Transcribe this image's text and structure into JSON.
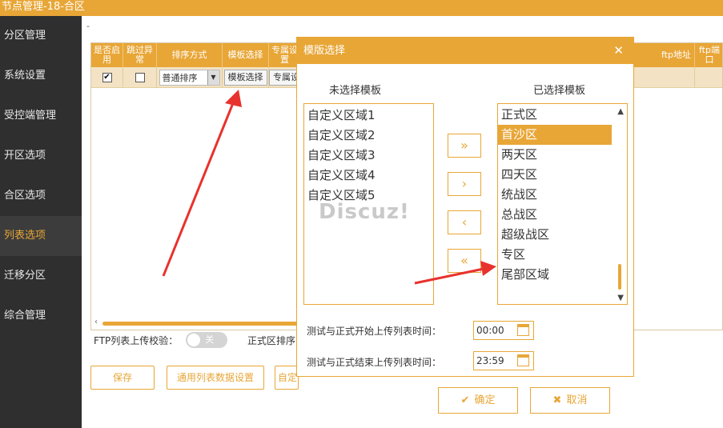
{
  "window": {
    "title": "节点管理-18-合区"
  },
  "sidebar": {
    "items": [
      {
        "label": "分区管理"
      },
      {
        "label": "系统设置"
      },
      {
        "label": "受控端管理"
      },
      {
        "label": "开区选项"
      },
      {
        "label": "合区选项"
      },
      {
        "label": "列表选项"
      },
      {
        "label": "迁移分区"
      },
      {
        "label": "综合管理"
      }
    ],
    "active_index": 5
  },
  "main": {
    "dash": "-",
    "table": {
      "headers": [
        "是否启用",
        "跳过异常",
        "排序方式",
        "模板选择",
        "专属设置",
        "ftp地址",
        "ftp端口"
      ],
      "row": {
        "enabled": true,
        "skip_error": false,
        "sort_value": "普通排序",
        "template_button": "模板选择",
        "exclusive_button": "专属设置"
      }
    },
    "ftp_check_label": "FTP列表上传校验：",
    "ftp_toggle_label": "关",
    "formal_sort_label": "正式区排序",
    "buttons": {
      "save": "保存",
      "common_list": "通用列表数据设置",
      "custom": "自定"
    }
  },
  "modal": {
    "title": "模版选择",
    "unselected_title": "未选择模板",
    "selected_title": "已选择模板",
    "unselected_items": [
      "自定义区域1",
      "自定义区域2",
      "自定义区域3",
      "自定义区域4",
      "自定义区域5"
    ],
    "selected_items": [
      "正式区",
      "首沙区",
      "两天区",
      "四天区",
      "统战区",
      "总战区",
      "超级战区",
      "专区",
      "尾部区域"
    ],
    "selected_highlight_index": 1,
    "move_buttons": [
      "»",
      "›",
      "‹",
      "«"
    ],
    "start_time_label": "测试与正式开始上传列表时间：",
    "start_time": "00:00",
    "end_time_label": "测试与正式结束上传列表时间：",
    "end_time": "23:59",
    "confirm": "确定",
    "cancel": "取消",
    "confirm_glyph": "✔",
    "cancel_glyph": "✖"
  },
  "watermark": "Discuz!",
  "colors": {
    "accent": "#e8a637",
    "sidebar_bg": "#2f2f2f",
    "annotation": "#e8322d"
  }
}
